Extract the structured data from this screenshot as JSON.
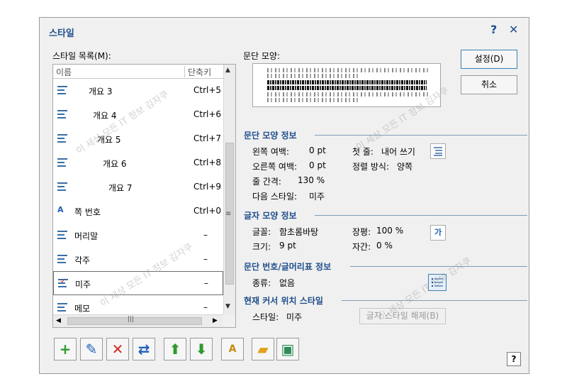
{
  "dialog": {
    "title": "스타일",
    "help_label": "?",
    "close_label": "✕"
  },
  "style_list": {
    "label": "스타일 목록(M):",
    "header_name": "이름",
    "header_shortcut": "단축키",
    "items": [
      {
        "name": "개요 3",
        "shortcut": "Ctrl+5",
        "icon": "outline-icon"
      },
      {
        "name": "개요 4",
        "shortcut": "Ctrl+6",
        "icon": "outline-icon"
      },
      {
        "name": "개요 5",
        "shortcut": "Ctrl+7",
        "icon": "outline-icon"
      },
      {
        "name": "개요 6",
        "shortcut": "Ctrl+8",
        "icon": "outline-icon"
      },
      {
        "name": "개요 7",
        "shortcut": "Ctrl+9",
        "icon": "outline-icon"
      },
      {
        "name": "쪽 번호",
        "shortcut": "Ctrl+0",
        "icon": "char-style-icon"
      },
      {
        "name": "머리말",
        "shortcut": "–",
        "icon": "paragraph-icon"
      },
      {
        "name": "각주",
        "shortcut": "–",
        "icon": "paragraph-icon"
      },
      {
        "name": "미주",
        "shortcut": "–",
        "icon": "paragraph-checked-icon",
        "selected": true
      },
      {
        "name": "메모",
        "shortcut": "–",
        "icon": "paragraph-icon"
      }
    ]
  },
  "preview": {
    "label": "문단 모양:"
  },
  "buttons": {
    "settings": "설정(D)",
    "cancel": "취소",
    "release_style": "글자 스타일 해제(B)"
  },
  "para_info": {
    "title": "문단 모양 정보",
    "left_margin_label": "왼쪽 여백:",
    "left_margin_value": "0 pt",
    "right_margin_label": "오른쪽 여백:",
    "right_margin_value": "0 pt",
    "line_spacing_label": "줄 간격:",
    "line_spacing_value": "130 %",
    "next_style_label": "다음 스타일:",
    "next_style_value": "미주",
    "first_line_label": "첫 줄:",
    "first_line_value": "내어 쓰기",
    "align_label": "정렬 방식:",
    "align_value": "양쪽"
  },
  "char_info": {
    "title": "글자 모양 정보",
    "font_label": "글꼴:",
    "font_value": "함초롬바탕",
    "size_label": "크기:",
    "size_value": "9 pt",
    "width_label": "장평:",
    "width_value": "100 %",
    "spacing_label": "자간:",
    "spacing_value": "0 %",
    "char_tile_label": "가"
  },
  "numbering_info": {
    "title": "문단 번호/글머리표 정보",
    "type_label": "종류:",
    "type_value": "없음"
  },
  "cursor_info": {
    "title": "현재 커서 위치 스타일",
    "style_label": "스타일:",
    "style_value": "미주"
  },
  "toolbar": [
    {
      "name": "add-style-icon",
      "glyph": "+",
      "color": "#2e9b2e"
    },
    {
      "name": "edit-style-icon",
      "glyph": "✎",
      "color": "#1f5fb8"
    },
    {
      "name": "delete-style-icon",
      "glyph": "✕",
      "color": "#d22a1f"
    },
    {
      "name": "replace-style-icon",
      "glyph": "⇄",
      "color": "#1f5fb8"
    },
    {
      "name": "move-up-icon",
      "glyph": "⬆",
      "color": "#2e9b2e"
    },
    {
      "name": "move-down-icon",
      "glyph": "⬇",
      "color": "#2e9b2e"
    },
    {
      "name": "style-template-icon",
      "glyph": "A",
      "color": "#c88a10"
    },
    {
      "name": "open-folder-icon",
      "glyph": "▰",
      "color": "#e0a21d"
    },
    {
      "name": "save-icon",
      "glyph": "▣",
      "color": "#2e8b57"
    }
  ],
  "watermark": "이 세상 모든 IT 정보 김자쿠",
  "colors": {
    "accent": "#1f4e8c",
    "section_line": "#7f9db9"
  }
}
